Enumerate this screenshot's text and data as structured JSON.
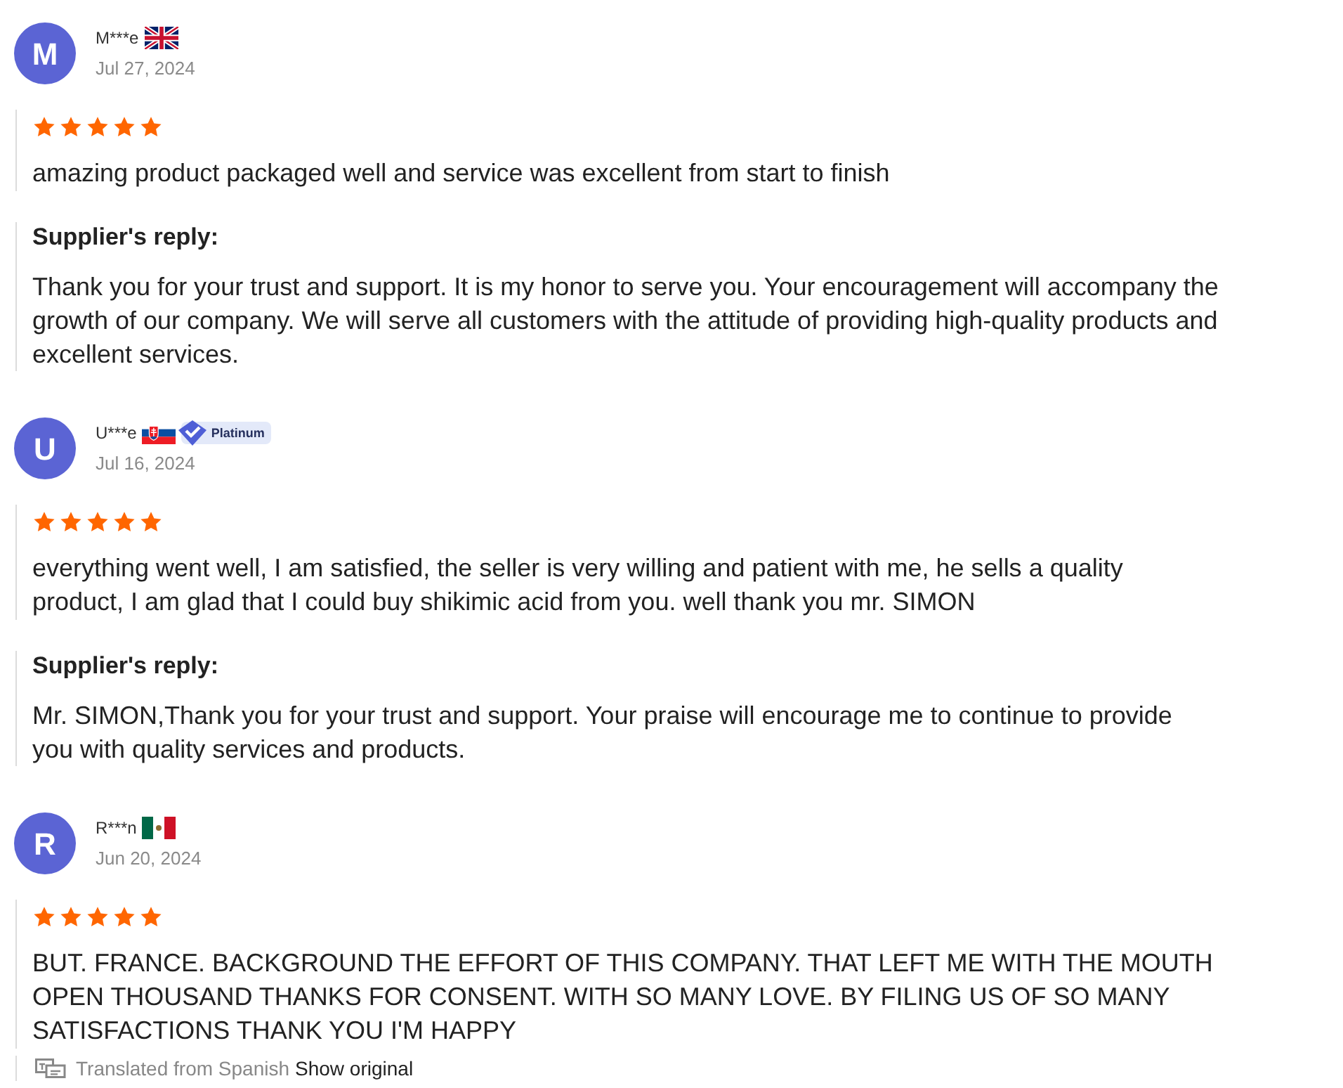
{
  "reviews": [
    {
      "initial": "M",
      "name": "M***e",
      "flag": {
        "kind": "uk"
      },
      "date": "Jul 27, 2024",
      "stars": 5,
      "text": "amazing product packaged well and service was excellent from start to finish",
      "reply": {
        "heading": "Supplier's reply:",
        "text": "Thank you for your trust and support. It is my honor to serve you. Your encouragement will accompany the growth of our company. We will serve all customers with the attitude of providing high-quality products and excellent services."
      }
    },
    {
      "initial": "U",
      "name": "U***e",
      "flag": {
        "kind": "slovakia"
      },
      "badge": "Platinum",
      "date": "Jul 16, 2024",
      "stars": 5,
      "text": "everything went well, I am satisfied, the seller is very willing and patient with me, he sells a quality product, I am glad that I could buy shikimic acid from you. well thank you mr. SIMON",
      "reply": {
        "heading": "Supplier's reply:",
        "text": "Mr. SIMON,Thank you for your trust and support. Your praise will encourage me to continue to provide you with quality services and products."
      }
    },
    {
      "initial": "R",
      "name": "R***n",
      "flag": {
        "kind": "mexico"
      },
      "date": "Jun 20, 2024",
      "stars": 5,
      "text": "BUT. FRANCE. BACKGROUND THE EFFORT OF THIS COMPANY. THAT LEFT ME WITH THE MOUTH OPEN THOUSAND THANKS FOR CONSENT. WITH SO MANY LOVE. BY FILING US OF SO MANY SATISFACTIONS THANK YOU I'M HAPPY",
      "translation": {
        "note": "Translated from Spanish",
        "link": "Show original"
      }
    }
  ]
}
